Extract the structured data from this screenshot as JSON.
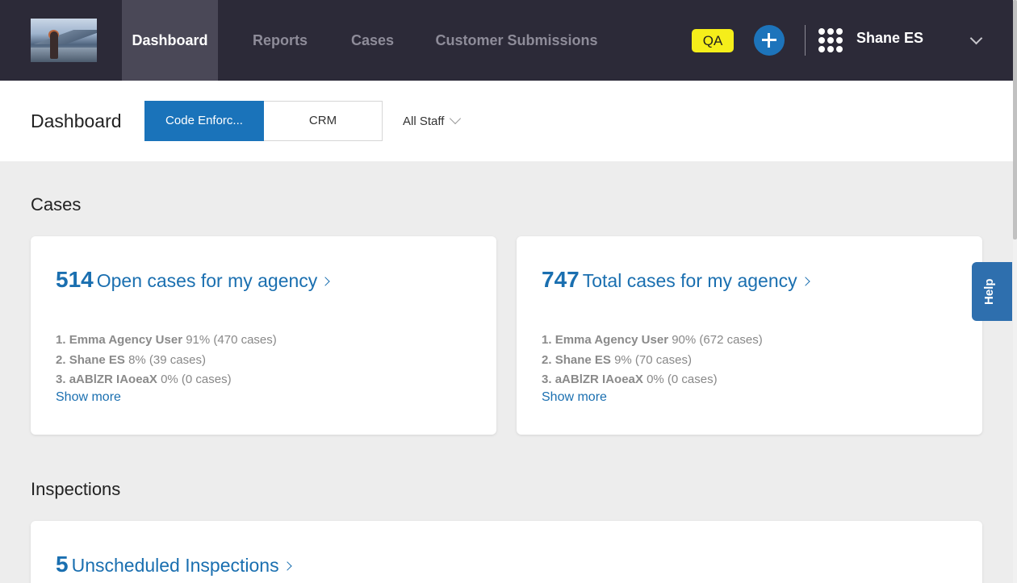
{
  "nav": {
    "tabs": [
      {
        "label": "Dashboard",
        "active": true
      },
      {
        "label": "Reports",
        "active": false
      },
      {
        "label": "Cases",
        "active": false
      },
      {
        "label": "Customer Submissions",
        "active": false
      }
    ],
    "env_badge": "QA",
    "user_name": "Shane ES"
  },
  "subheader": {
    "title": "Dashboard",
    "segments": [
      "Code Enforc...",
      "CRM"
    ],
    "active_segment": "Code Enforc...",
    "staff_filter": "All Staff"
  },
  "cases": {
    "section_title": "Cases",
    "open": {
      "count": "514",
      "label": "Open cases for my agency",
      "ranks": [
        {
          "rank": "1.",
          "name": "Emma Agency User",
          "stat": "91% (470 cases)"
        },
        {
          "rank": "2.",
          "name": "Shane ES",
          "stat": "8% (39 cases)"
        },
        {
          "rank": "3.",
          "name": "aABlZR IAoeaX",
          "stat": "0% (0 cases)"
        }
      ],
      "show_more": "Show more"
    },
    "total": {
      "count": "747",
      "label": "Total cases for my agency",
      "ranks": [
        {
          "rank": "1.",
          "name": "Emma Agency User",
          "stat": "90% (672 cases)"
        },
        {
          "rank": "2.",
          "name": "Shane ES",
          "stat": "9% (70 cases)"
        },
        {
          "rank": "3.",
          "name": "aABlZR IAoeaX",
          "stat": "0% (0 cases)"
        }
      ],
      "show_more": "Show more"
    }
  },
  "inspections": {
    "section_title": "Inspections",
    "unscheduled": {
      "count": "5",
      "label": "Unscheduled Inspections"
    }
  },
  "help": {
    "label": "Help"
  },
  "colors": {
    "nav_bg": "#2c2a38",
    "nav_active": "#4a4857",
    "accent": "#1a73ba",
    "link": "#1a6fb0",
    "qa_badge": "#f5ee1a",
    "page_bg": "#ededed"
  },
  "icons": {
    "logo": "profile-photo-icon",
    "add": "plus-circle-icon",
    "apps": "app-grid-icon",
    "user_menu": "chevron-down-icon",
    "card_link": "chevron-right-icon",
    "filter": "chevron-down-icon"
  }
}
